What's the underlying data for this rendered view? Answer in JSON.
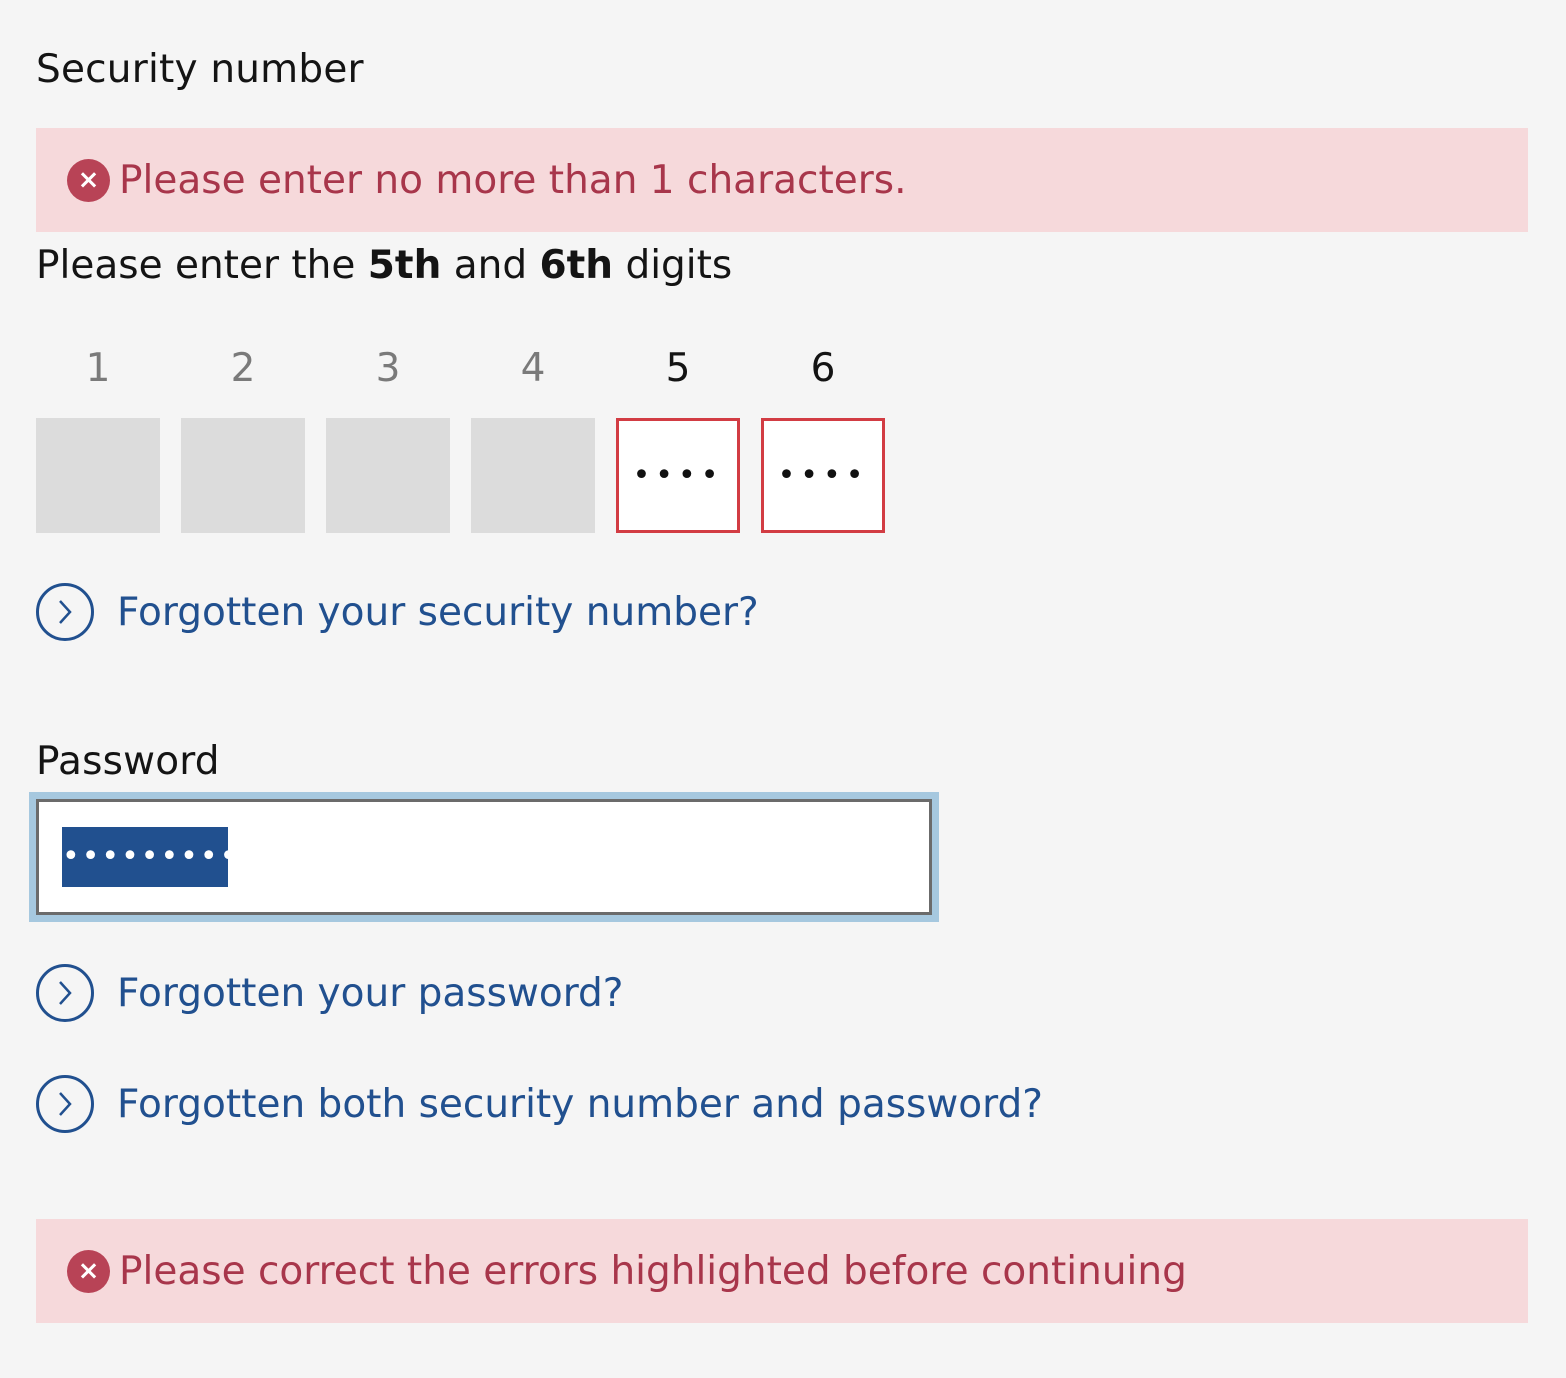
{
  "security": {
    "label": "Security number",
    "error": "Please enter no more than 1 characters.",
    "instruction": {
      "prefix": "Please enter the ",
      "first": "5th",
      "middle": " and ",
      "second": "6th",
      "suffix": " digits"
    },
    "digits": [
      {
        "number": "1",
        "active": false,
        "value": ""
      },
      {
        "number": "2",
        "active": false,
        "value": ""
      },
      {
        "number": "3",
        "active": false,
        "value": ""
      },
      {
        "number": "4",
        "active": false,
        "value": ""
      },
      {
        "number": "5",
        "active": true,
        "value": "••••"
      },
      {
        "number": "6",
        "active": true,
        "value": "••••"
      }
    ],
    "forgot_link": "Forgotten your security number?"
  },
  "password": {
    "label": "Password",
    "value": "•••••••••"
  },
  "links": {
    "forgot_password": "Forgotten your password?",
    "forgot_both": "Forgotten both security number and password?"
  },
  "form_error": "Please correct the errors highlighted before continuing",
  "icons": {
    "error": "error-x-icon",
    "link": "chevron-right-circle-icon"
  },
  "colors": {
    "background": "#f5f5f5",
    "error_banner": "#f6d9db",
    "error_text": "#a8364b",
    "error_icon": "#b84356",
    "link": "#21508f",
    "active_digit_border": "#d23c43",
    "focus_ring": "#a6c8df"
  }
}
